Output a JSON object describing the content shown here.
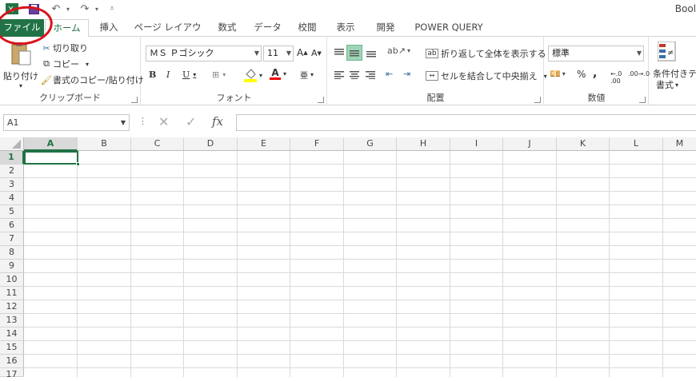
{
  "title": "Bool",
  "tabs": [
    {
      "label": "ファイル"
    },
    {
      "label": "ホーム"
    },
    {
      "label": "挿入"
    },
    {
      "label": "ページ レイアウト"
    },
    {
      "label": "数式"
    },
    {
      "label": "データ"
    },
    {
      "label": "校閲"
    },
    {
      "label": "表示"
    },
    {
      "label": "開発"
    },
    {
      "label": "POWER QUERY"
    }
  ],
  "clipboard": {
    "group_label": "クリップボード",
    "paste": "貼り付け",
    "cut": "切り取り",
    "copy": "コピー",
    "format_painter": "書式のコピー/貼り付け"
  },
  "font": {
    "group_label": "フォント",
    "font_name": "ＭＳ Ｐゴシック",
    "font_size": "11"
  },
  "alignment": {
    "group_label": "配置",
    "wrap_text": "折り返して全体を表示する",
    "merge_center": "セルを結合して中央揃え"
  },
  "number": {
    "group_label": "数値",
    "format": "標準",
    "percent": "%",
    "comma": ","
  },
  "styles": {
    "conditional": "条件付き",
    "format_label": "書式"
  },
  "formula_bar": {
    "name_box": "A1",
    "fx": "fx",
    "formula": ""
  },
  "columns": [
    "A",
    "B",
    "C",
    "D",
    "E",
    "F",
    "G",
    "H",
    "I",
    "J",
    "K",
    "L",
    "M"
  ],
  "rows": [
    "1",
    "2",
    "3",
    "4",
    "5",
    "6",
    "7",
    "8",
    "9",
    "10",
    "11",
    "12",
    "13",
    "14",
    "15",
    "16",
    "17"
  ],
  "colors": {
    "accent": "#217346",
    "annotation_circle": "#d9121a"
  }
}
